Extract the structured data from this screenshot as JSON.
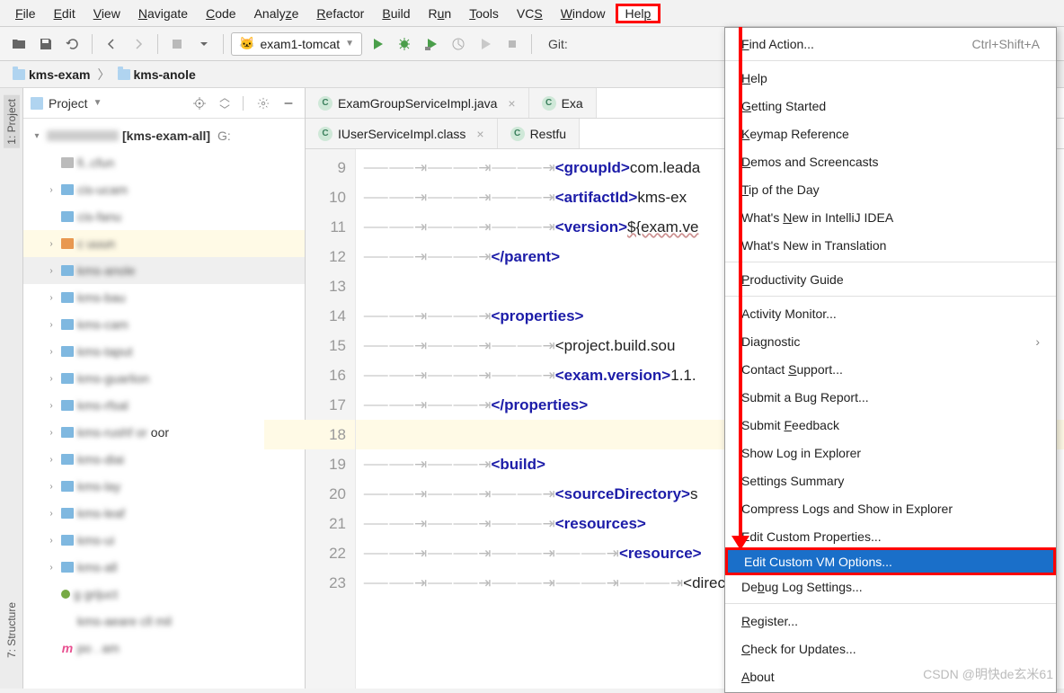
{
  "menu": [
    "File",
    "Edit",
    "View",
    "Navigate",
    "Code",
    "Analyze",
    "Refactor",
    "Build",
    "Run",
    "Tools",
    "VCS",
    "Window",
    "Help"
  ],
  "menu_ul": [
    "F",
    "E",
    "V",
    "N",
    "C",
    "z",
    "R",
    "B",
    "u",
    "T",
    "S",
    "W",
    "p"
  ],
  "run_config": "exam1-tomcat",
  "git_label": "Git:",
  "breadcrumb": [
    "kms-exam",
    "kms-anole"
  ],
  "project_panel": {
    "title": "Project"
  },
  "tree": {
    "root": "[kms-exam-all]",
    "root_suffix": "G:",
    "items": [
      {
        "chev": "",
        "icon": "grey",
        "label": "fi..cfun"
      },
      {
        "chev": "›",
        "icon": "blue",
        "label": "cis-ucam"
      },
      {
        "chev": "",
        "icon": "blue",
        "label": "cis-fanu"
      },
      {
        "chev": "›",
        "icon": "orange",
        "label": "c uuun",
        "sel": true
      },
      {
        "chev": "›",
        "icon": "blue",
        "label": "kms-anole",
        "sel2": true,
        "bold": true
      },
      {
        "chev": "›",
        "icon": "blue",
        "label": "kms-bau"
      },
      {
        "chev": "›",
        "icon": "blue",
        "label": "kms-cam"
      },
      {
        "chev": "›",
        "icon": "blue",
        "label": "kms-taput"
      },
      {
        "chev": "›",
        "icon": "blue",
        "label": "kms-guarlion"
      },
      {
        "chev": "›",
        "icon": "blue",
        "label": "kms-rfsal"
      },
      {
        "chev": "›",
        "icon": "blue",
        "label": "kms-rushf or",
        "extra": "oor"
      },
      {
        "chev": "›",
        "icon": "blue",
        "label": "kms-diai"
      },
      {
        "chev": "›",
        "icon": "blue",
        "label": "kms-lay"
      },
      {
        "chev": "›",
        "icon": "blue",
        "label": "kms-leaf"
      },
      {
        "chev": "›",
        "icon": "blue",
        "label": "kms-ui"
      },
      {
        "chev": "›",
        "icon": "blue",
        "label": "kms-all"
      },
      {
        "chev": "",
        "icon": "dot",
        "label": "g grijuct"
      },
      {
        "chev": "",
        "icon": "text",
        "label": "kms-aeare cll mil"
      },
      {
        "chev": "",
        "icon": "m",
        "label": "po . am"
      }
    ]
  },
  "tabs_row1": [
    {
      "label": "ExamGroupServiceImpl.java",
      "close": true
    },
    {
      "label": "Exa",
      "close": false
    }
  ],
  "tabs_row2": [
    {
      "label": "IUserServiceImpl.class",
      "close": true
    },
    {
      "label": "Restfu",
      "close": false
    }
  ],
  "code": {
    "start": 9,
    "lines": [
      {
        "n": 9,
        "indent": 3,
        "html": "<groupId>com.leada"
      },
      {
        "n": 10,
        "indent": 3,
        "html": "<artifactId>kms-ex"
      },
      {
        "n": 11,
        "indent": 3,
        "html": "<version>${exam.ve",
        "err": true
      },
      {
        "n": 12,
        "indent": 2,
        "html": "</parent>"
      },
      {
        "n": 13,
        "indent": 0,
        "html": ""
      },
      {
        "n": 14,
        "indent": 2,
        "html": "<properties>"
      },
      {
        "n": 15,
        "indent": 3,
        "html": "<project.build.sou"
      },
      {
        "n": 16,
        "indent": 3,
        "html": "<exam.version>1.1."
      },
      {
        "n": 17,
        "indent": 2,
        "html": "</properties>"
      },
      {
        "n": 18,
        "indent": 0,
        "html": "",
        "blank": true
      },
      {
        "n": 19,
        "indent": 2,
        "html": "<build>"
      },
      {
        "n": 20,
        "indent": 3,
        "html": "<sourceDirectory>s"
      },
      {
        "n": 21,
        "indent": 3,
        "html": "<resources>"
      },
      {
        "n": 22,
        "indent": 4,
        "html": "<resource>"
      },
      {
        "n": 23,
        "indent": 5,
        "html": "<directory"
      }
    ]
  },
  "help_menu": [
    {
      "label": "Find Action...",
      "ul": "F",
      "shortcut": "Ctrl+Shift+A"
    },
    {
      "sep": true
    },
    {
      "label": "Help",
      "ul": "H"
    },
    {
      "label": "Getting Started",
      "ul": "G"
    },
    {
      "label": "Keymap Reference",
      "ul": "K"
    },
    {
      "label": "Demos and Screencasts",
      "ul": "D"
    },
    {
      "label": "Tip of the Day",
      "ul": "T"
    },
    {
      "label": "What's New in IntelliJ IDEA",
      "ul": "N",
      "ulpos": 7
    },
    {
      "label": "What's New in Translation"
    },
    {
      "sep": true
    },
    {
      "label": "Productivity Guide",
      "ul": "P"
    },
    {
      "sep": true
    },
    {
      "label": "Activity Monitor..."
    },
    {
      "label": "Diagnostic",
      "arrow": true
    },
    {
      "label": "Contact Support...",
      "ul": "S",
      "ulpos": 8
    },
    {
      "label": "Submit a Bug Report..."
    },
    {
      "label": "Submit Feedback",
      "ul": "F",
      "ulpos": 7
    },
    {
      "label": "Show Log in Explorer"
    },
    {
      "label": "Settings Summary"
    },
    {
      "label": "Compress Logs and Show in Explorer"
    },
    {
      "label": "Edit Custom Properties..."
    },
    {
      "label": "Edit Custom VM Options...",
      "sel": true,
      "highlight": true
    },
    {
      "label": "Debug Log Settings...",
      "ul": "b",
      "ulpos": 2
    },
    {
      "sep": true
    },
    {
      "label": "Register...",
      "ul": "R"
    },
    {
      "label": "Check for Updates...",
      "ul": "C"
    },
    {
      "label": "About",
      "ul": "A"
    }
  ],
  "sidebar_tabs": [
    "1: Project",
    "7: Structure"
  ],
  "watermark": "CSDN @明快de玄米61"
}
